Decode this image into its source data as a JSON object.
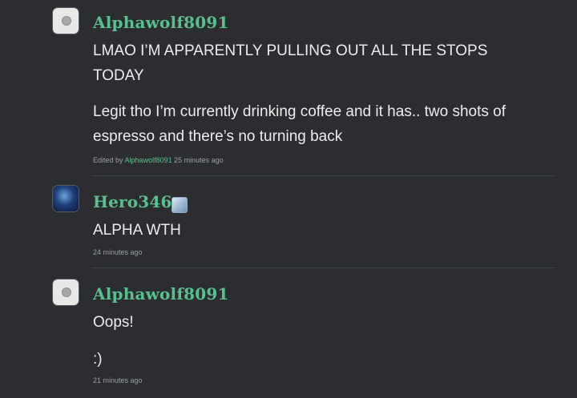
{
  "comments": [
    {
      "username": "Alphawolf8091",
      "paragraphs": [
        "LMAO I’M APPARENTLY PULLING OUT ALL THE STOPS TODAY",
        "Legit tho I’m currently drinking coffee and it has.. two shots of espresso and there’s no turning back"
      ],
      "edited_prefix": "Edited by",
      "edited_by": "Alphawolf8091",
      "timestamp": "25 minutes ago"
    },
    {
      "username": "Hero346",
      "badge_icon": "user-badge-icon",
      "paragraphs": [
        "ALPHA WTH"
      ],
      "timestamp": "24 minutes ago"
    },
    {
      "username": "Alphawolf8091",
      "paragraphs": [
        "Oops!",
        ":)"
      ],
      "timestamp": "21 minutes ago"
    }
  ],
  "colors": {
    "background": "#2b2d31",
    "username": "#58c08f",
    "text": "#ececed",
    "meta": "#9b9ea3"
  }
}
